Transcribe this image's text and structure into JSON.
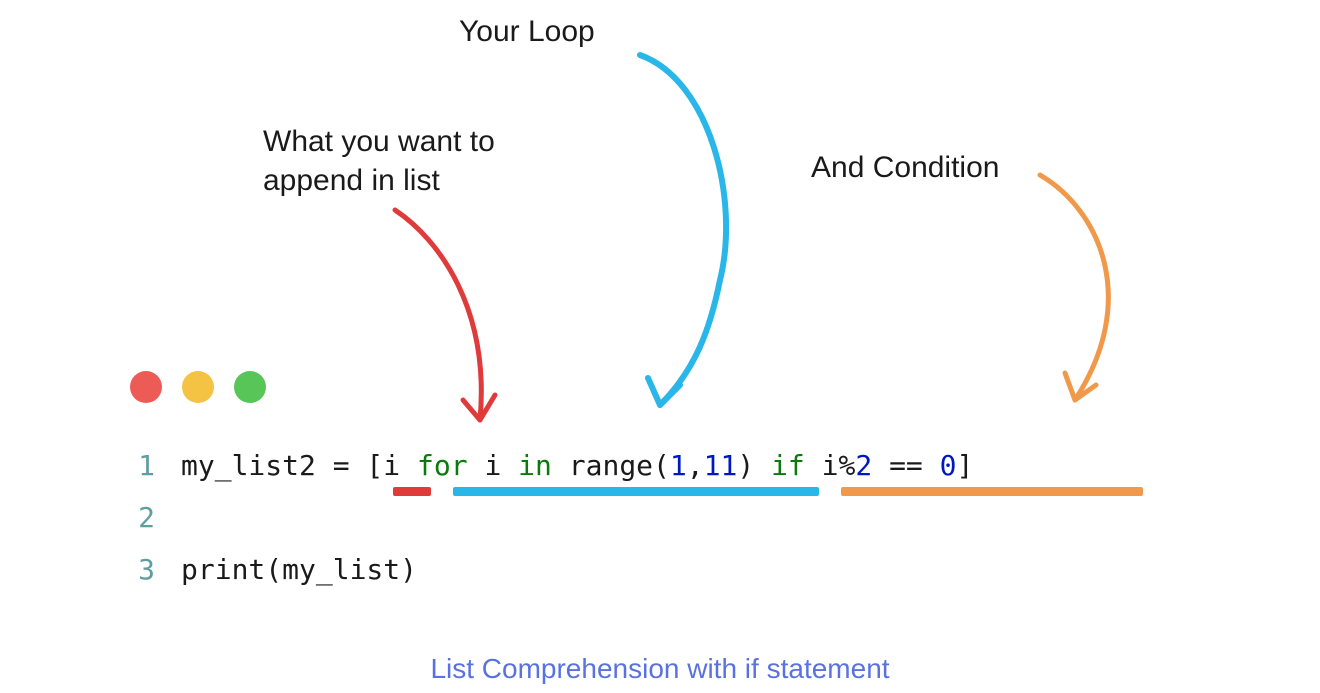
{
  "annotations": {
    "loop": "Your Loop",
    "append_line1": "What you want to",
    "append_line2": "append in list",
    "condition": "And Condition"
  },
  "colors": {
    "red": "#ed5b56",
    "yellow": "#f5c344",
    "green": "#58c558",
    "arrow_red": "#e03b3b",
    "arrow_blue": "#29b6e8",
    "arrow_orange": "#f0994a",
    "caption": "#5a72e0"
  },
  "code": {
    "line1": {
      "num": "1",
      "t1": "my_list2 = [i ",
      "kw1": "for",
      "t2": " i ",
      "kw2": "in",
      "t3": " range(",
      "n1": "1",
      "t4": ",",
      "n2": "11",
      "t5": ") ",
      "kw3": "if",
      "t6": " i%",
      "n3": "2",
      "t7": " == ",
      "n4": "0",
      "t8": "]"
    },
    "line2": {
      "num": "2",
      "text": ""
    },
    "line3": {
      "num": "3",
      "text": "print(my_list)"
    }
  },
  "caption": "List Comprehension with if statement"
}
